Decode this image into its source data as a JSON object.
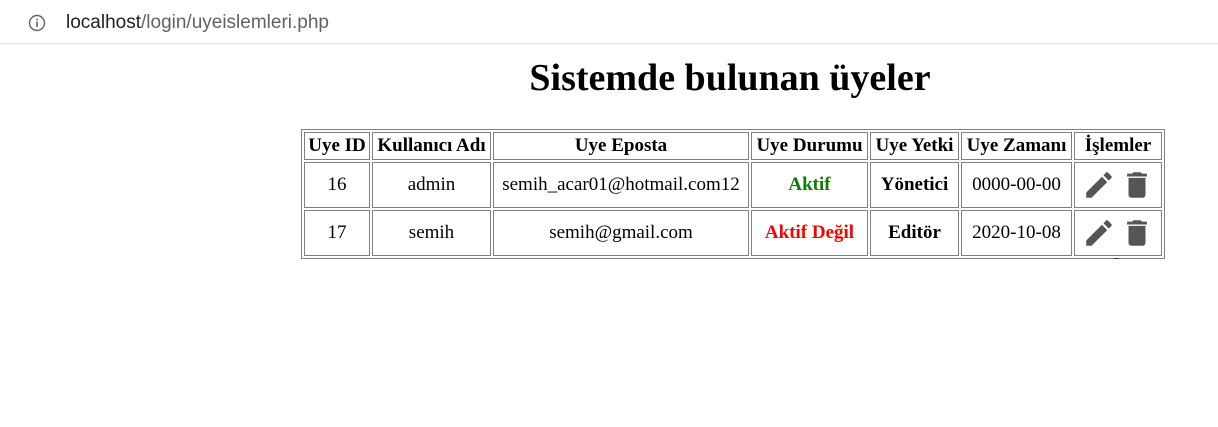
{
  "browser": {
    "url_host": "localhost",
    "url_path": "/login/uyeislemleri.php"
  },
  "page": {
    "title": "Sistemde bulunan üyeler"
  },
  "table": {
    "headers": [
      "Uye ID",
      "Kullanıcı Adı",
      "Uye Eposta",
      "Uye Durumu",
      "Uye Yetki",
      "Uye Zamanı",
      "İşlemler"
    ],
    "rows": [
      {
        "id": "16",
        "username": "admin",
        "email": "semih_acar01@hotmail.com12",
        "status": "Aktif",
        "role": "Yönetici",
        "date": "0000-00-00"
      },
      {
        "id": "17",
        "username": "semih",
        "email": "semih@gmail.com",
        "status": "Aktif Değil",
        "role": "Editör",
        "date": "2020-10-08"
      }
    ]
  },
  "colors": {
    "active": "#0b7a0b",
    "inactive": "#ff0000",
    "icon": "#555555"
  },
  "icons": {
    "edit": "pencil-icon",
    "delete": "trash-icon"
  }
}
